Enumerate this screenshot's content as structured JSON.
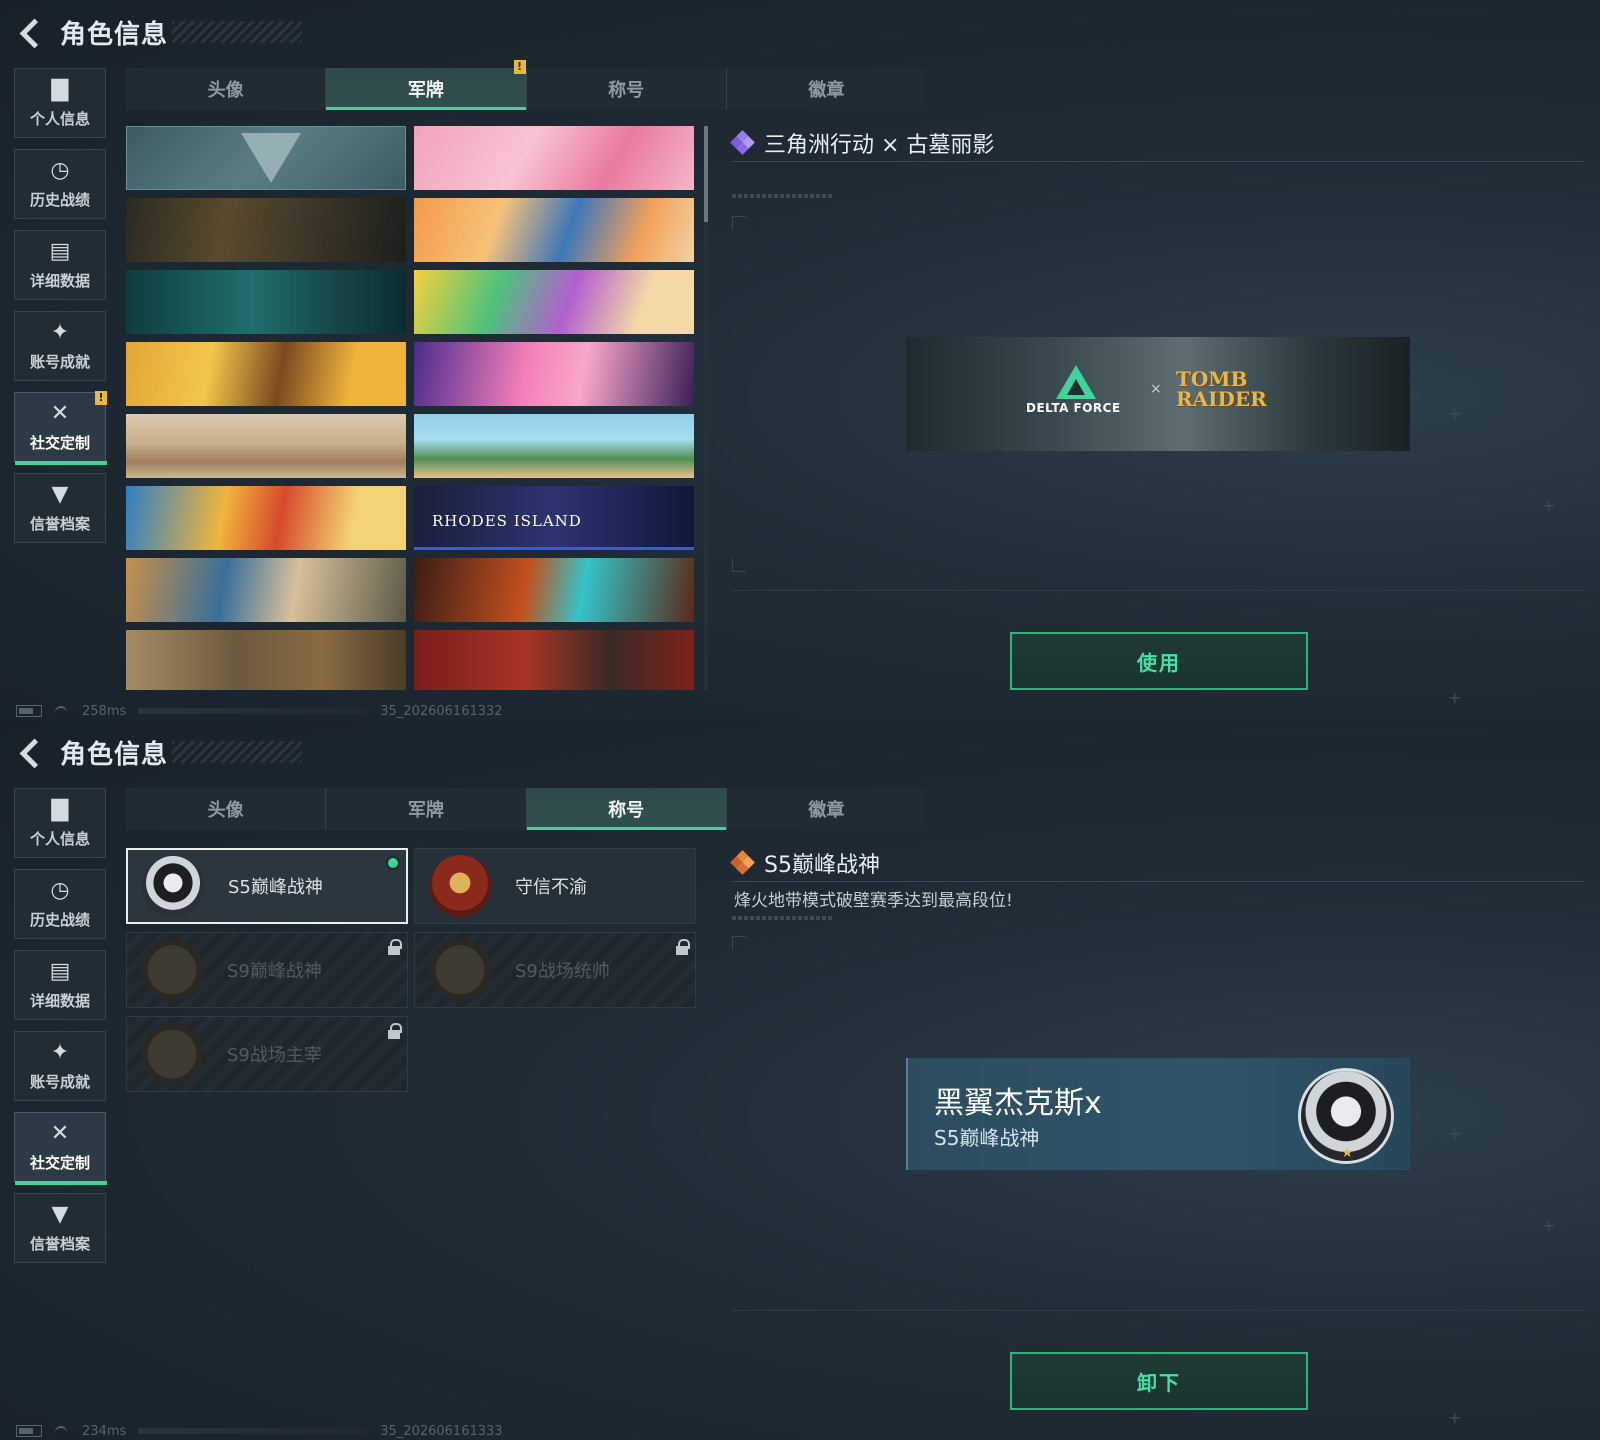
{
  "header": {
    "title": "角色信息"
  },
  "sidebar": {
    "items": [
      {
        "label": "个人信息",
        "glyph": "▇"
      },
      {
        "label": "历史战绩",
        "glyph": "◷"
      },
      {
        "label": "详细数据",
        "glyph": "▤"
      },
      {
        "label": "账号成就",
        "glyph": "✦"
      },
      {
        "label": "社交定制",
        "glyph": "✕"
      },
      {
        "label": "信誉档案",
        "glyph": "▼"
      }
    ],
    "badge": "!"
  },
  "tabs": [
    "头像",
    "军牌",
    "称号",
    "徽章"
  ],
  "tab_badge": "!",
  "panel1": {
    "active_tab": "军牌",
    "detail_title": "三角洲行动 × 古墓丽影",
    "banner_text": "RHODES ISLAND",
    "preview": {
      "left_logo": "DELTA FORCE",
      "x": "×",
      "right_logo": "TOMB RAIDER"
    },
    "action_label": "使用",
    "status": {
      "ping": "258ms",
      "build": "35_202606161332"
    }
  },
  "panel2": {
    "active_tab": "称号",
    "detail_title": "S5巅峰战神",
    "detail_desc": "烽火地带模式破壁赛季达到最高段位!",
    "titles": [
      {
        "name": "S5巅峰战神",
        "state": "selected"
      },
      {
        "name": "守信不渝",
        "state": "owned"
      },
      {
        "name": "S9巅峰战神",
        "state": "locked"
      },
      {
        "name": "S9战场统帅",
        "state": "locked"
      },
      {
        "name": "S9战场主宰",
        "state": "locked"
      }
    ],
    "nameplate": {
      "name": "黑翼杰克斯x",
      "title": "S5巅峰战神"
    },
    "action_label": "卸下",
    "status": {
      "ping": "234ms",
      "build": "35_202606161333"
    }
  },
  "colors": {
    "accent": "#3fd49b",
    "badge": "#e8b93a",
    "diamond1": "#9b7cf0",
    "diamond2": "#e5873a"
  }
}
